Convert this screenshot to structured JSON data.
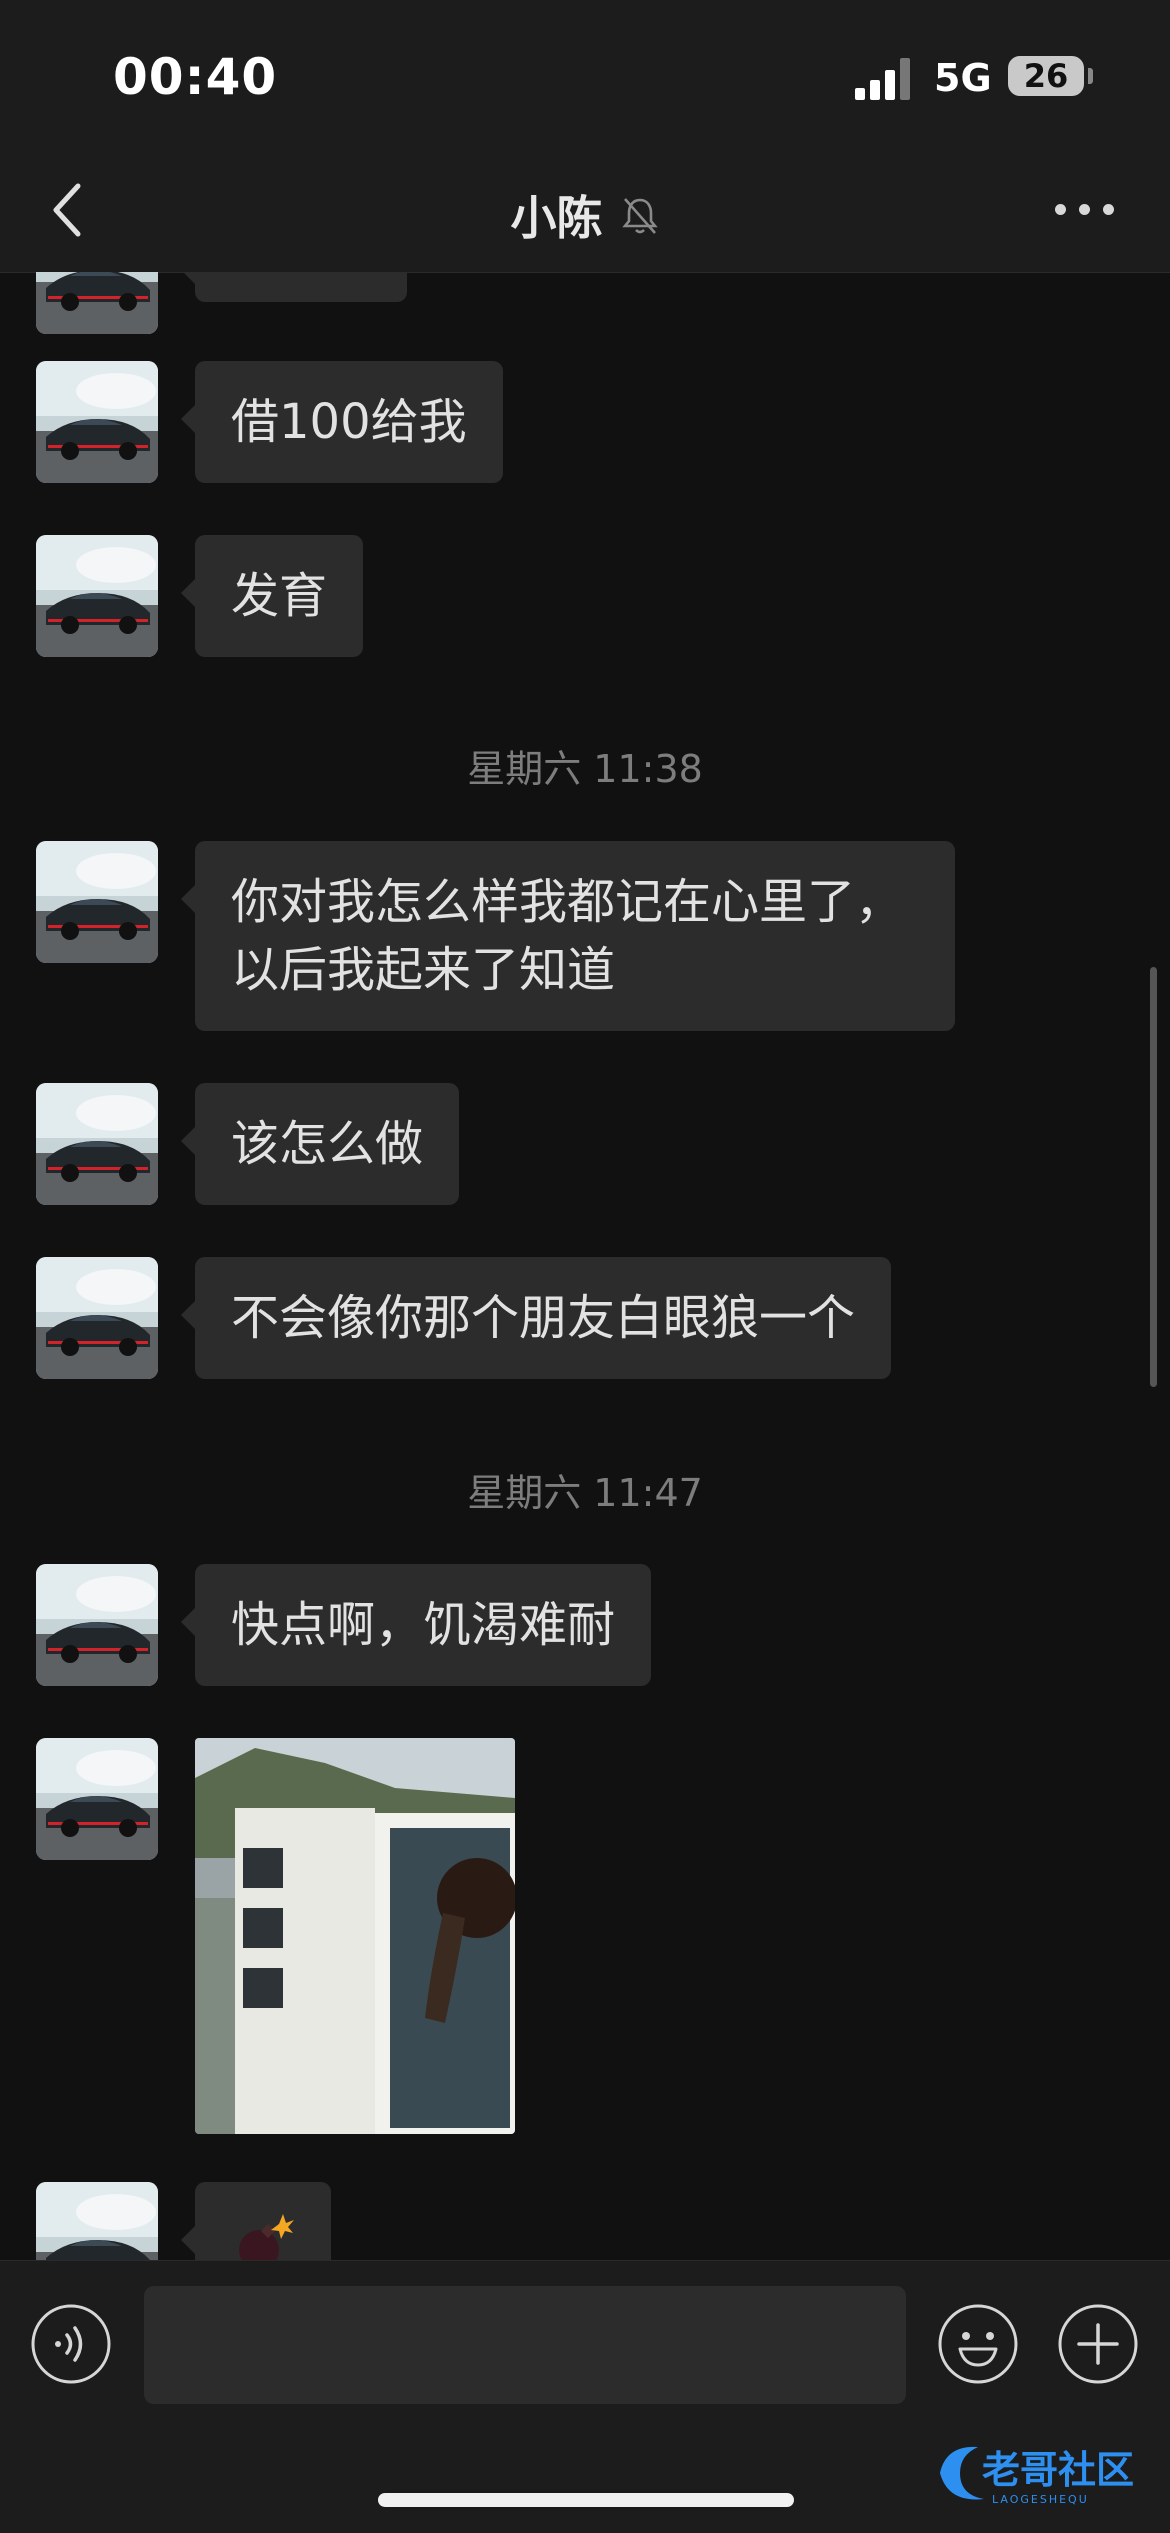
{
  "status_bar": {
    "time": "00:40",
    "network": "5G",
    "battery": "26"
  },
  "nav": {
    "title": "小陈",
    "back_icon": "chevron-left-icon",
    "mute_icon": "bell-slash-icon",
    "more_icon": "ellipsis-icon"
  },
  "messages": [
    {
      "type": "text",
      "text": "借100给我"
    },
    {
      "type": "text",
      "text": "发育"
    },
    {
      "type": "timestamp",
      "text": "星期六 11:38"
    },
    {
      "type": "text",
      "text": "你对我怎么样我都记在心里了，以后我起来了知道"
    },
    {
      "type": "text",
      "text": "该怎么做"
    },
    {
      "type": "text",
      "text": "不会像你那个朋友白眼狼一个"
    },
    {
      "type": "timestamp",
      "text": "星期六 11:47"
    },
    {
      "type": "text",
      "text": "快点啊，饥渴难耐"
    },
    {
      "type": "image"
    },
    {
      "type": "emoji",
      "icon": "bomb-icon"
    }
  ],
  "input_bar": {
    "voice_icon": "voice-icon",
    "emoji_icon": "smiley-icon",
    "plus_icon": "plus-icon",
    "value": ""
  },
  "watermark": {
    "text": "老哥社区",
    "sub": "LAOGESHEQU"
  },
  "colors": {
    "background": "#111111",
    "bar": "#1c1c1c",
    "bubble": "#2c2c2c"
  }
}
